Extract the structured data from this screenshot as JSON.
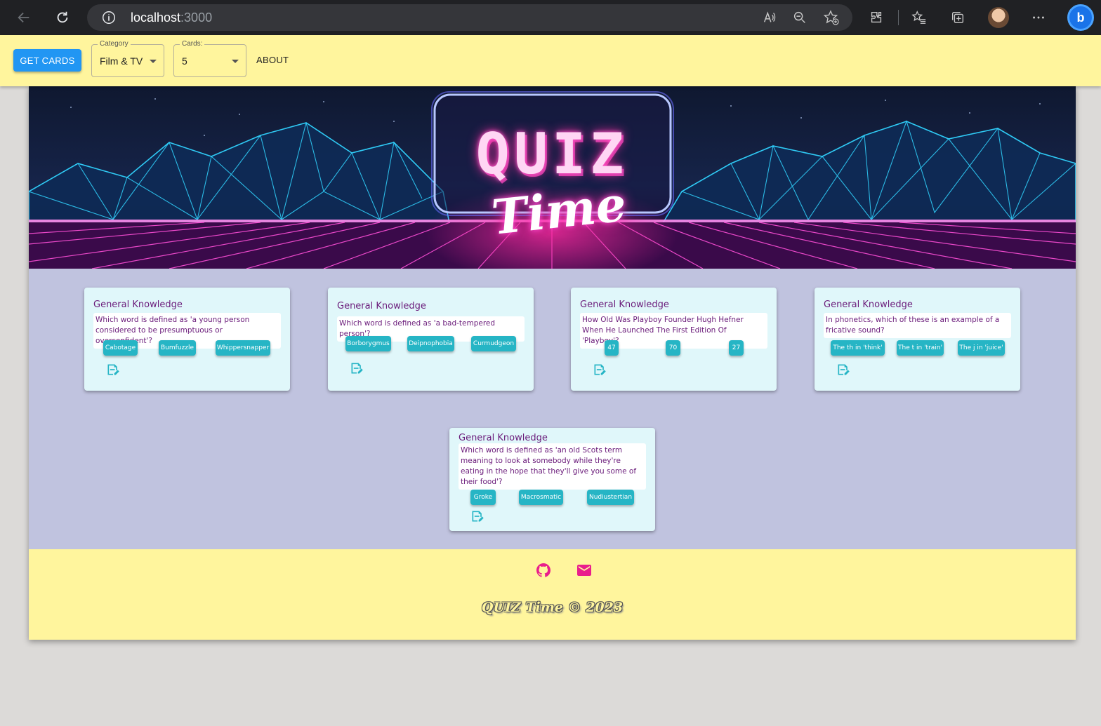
{
  "browser": {
    "url_host": "localhost",
    "url_port": ":3000"
  },
  "toolbar": {
    "get_cards_label": "GET CARDS",
    "category_label": "Category",
    "category_value": "Film & TV",
    "cards_label": "Cards:",
    "cards_value": "5",
    "about_label": "ABOUT"
  },
  "hero": {
    "logo_line1": "QUIZ",
    "logo_line2": "Time"
  },
  "cards": [
    {
      "category": "General Knowledge",
      "question": "Which word is defined as 'a young person considered to be presumptuous or overconfident'?",
      "answers": [
        "Cabotage",
        "Bumfuzzle",
        "Whippersnapper"
      ]
    },
    {
      "category": "General Knowledge",
      "question": "Which word is defined as 'a bad-tempered person'?",
      "answers": [
        "Borborygmus",
        "Deipnophobia",
        "Curmudgeon"
      ]
    },
    {
      "category": "General Knowledge",
      "question": "How Old Was Playboy Founder Hugh Hefner When He Launched The First Edition Of 'Playboy'?",
      "answers": [
        "47",
        "70",
        "27"
      ]
    },
    {
      "category": "General Knowledge",
      "question": "In phonetics, which of these is an example of a fricative sound?",
      "answers": [
        "The th in 'think'",
        "The t in 'train'",
        "The j in 'juice'"
      ]
    },
    {
      "category": "General Knowledge",
      "question": "Which word is defined as 'an old Scots term meaning to look at somebody while they're eating in the hope that they'll give you some of their food'?",
      "answers": [
        "Groke",
        "Macrosmatic",
        "Nudiustertian"
      ]
    }
  ],
  "footer": {
    "copyright": "QUIZ Time © 2023"
  },
  "colors": {
    "toolbar_bg": "#fff59d",
    "primary_button": "#2196f3",
    "answer_button": "#26b5c5",
    "card_bg": "#e0f7fa",
    "card_text": "#6a1b7a",
    "footer_icon": "#e91e8c",
    "page_bg": "#c0c3df"
  }
}
